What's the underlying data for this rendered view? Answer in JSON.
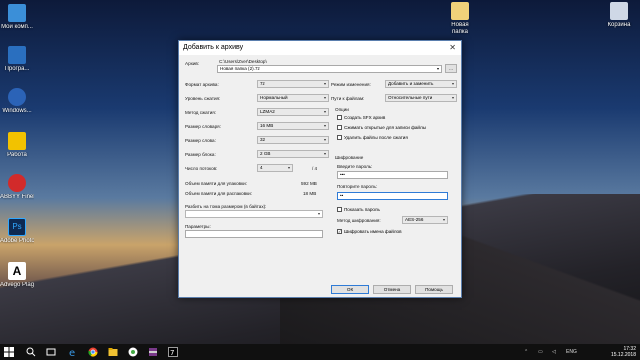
{
  "desktop": {
    "icons_left": [
      {
        "label": "Мой комп...",
        "color": "#3b8fd8"
      },
      {
        "label": "Програ...",
        "color": "#2a6fbf"
      },
      {
        "label": "Windows...",
        "color": "#2b63b7"
      },
      {
        "label": "Работа",
        "color": "#f2c200"
      },
      {
        "label": "ABBYY FineRea...",
        "color": "#d22a2a"
      },
      {
        "label": "Adobe Photosh...",
        "color": "#0e2a52"
      },
      {
        "label": "Advego Plagiatus",
        "color": "#ffffff"
      }
    ],
    "icons_right": [
      {
        "label": "Новая папка",
        "color": "#f1d27a"
      },
      {
        "label": "Корзина",
        "color": "#cfd8e6"
      }
    ]
  },
  "dialog": {
    "title": "Добавить к архиву",
    "archive_label": "Архив:",
    "archive_path": "C:\\Users\\Zver\\Desktop\\",
    "archive_name": "Новая папка (2).7z",
    "browse_label": "...",
    "left": {
      "format_label": "Формат архива:",
      "format_value": "7z",
      "level_label": "Уровень сжатия:",
      "level_value": "Нормальный",
      "method_label": "Метод сжатия:",
      "method_value": "LZMA2",
      "dict_label": "Размер словаря:",
      "dict_value": "16 MB",
      "word_label": "Размер слова:",
      "word_value": "32",
      "block_label": "Размер блока:",
      "block_value": "2 GB",
      "threads_label": "Число потоков:",
      "threads_value": "4",
      "threads_total": "/ 4",
      "mem_pack_label": "Объем памяти для упаковки:",
      "mem_pack_value": "592 MB",
      "mem_unpack_label": "Объем памяти для распаковки:",
      "mem_unpack_value": "18 MB",
      "split_label": "Разбить на тома размером (в байтах):",
      "params_label": "Параметры:"
    },
    "right": {
      "update_label": "Режим изменения:",
      "update_value": "Добавить и заменить",
      "paths_label": "Пути к файлам:",
      "paths_value": "Относительные пути",
      "options_title": "Опции",
      "opt_sfx": "Создать SFX архив",
      "opt_shared": "Сжимать открытые для записи файлы",
      "opt_delete": "Удалить файлы после сжатия",
      "enc_title": "Шифрование",
      "pw_label": "Введите пароль:",
      "pw_value": "•••",
      "pw2_label": "Повторите пароль:",
      "pw2_value": "••",
      "show_pw": "Показать пароль",
      "enc_method_label": "Метод шифрования:",
      "enc_method_value": "AES-256",
      "enc_names": "Шифровать имена файлов",
      "enc_names_checked": true
    },
    "buttons": {
      "ok": "ОК",
      "cancel": "Отмена",
      "help": "Помощь"
    }
  },
  "taskbar": {
    "lang": "ENG",
    "time": "17:32",
    "date": "15.12.2018"
  }
}
